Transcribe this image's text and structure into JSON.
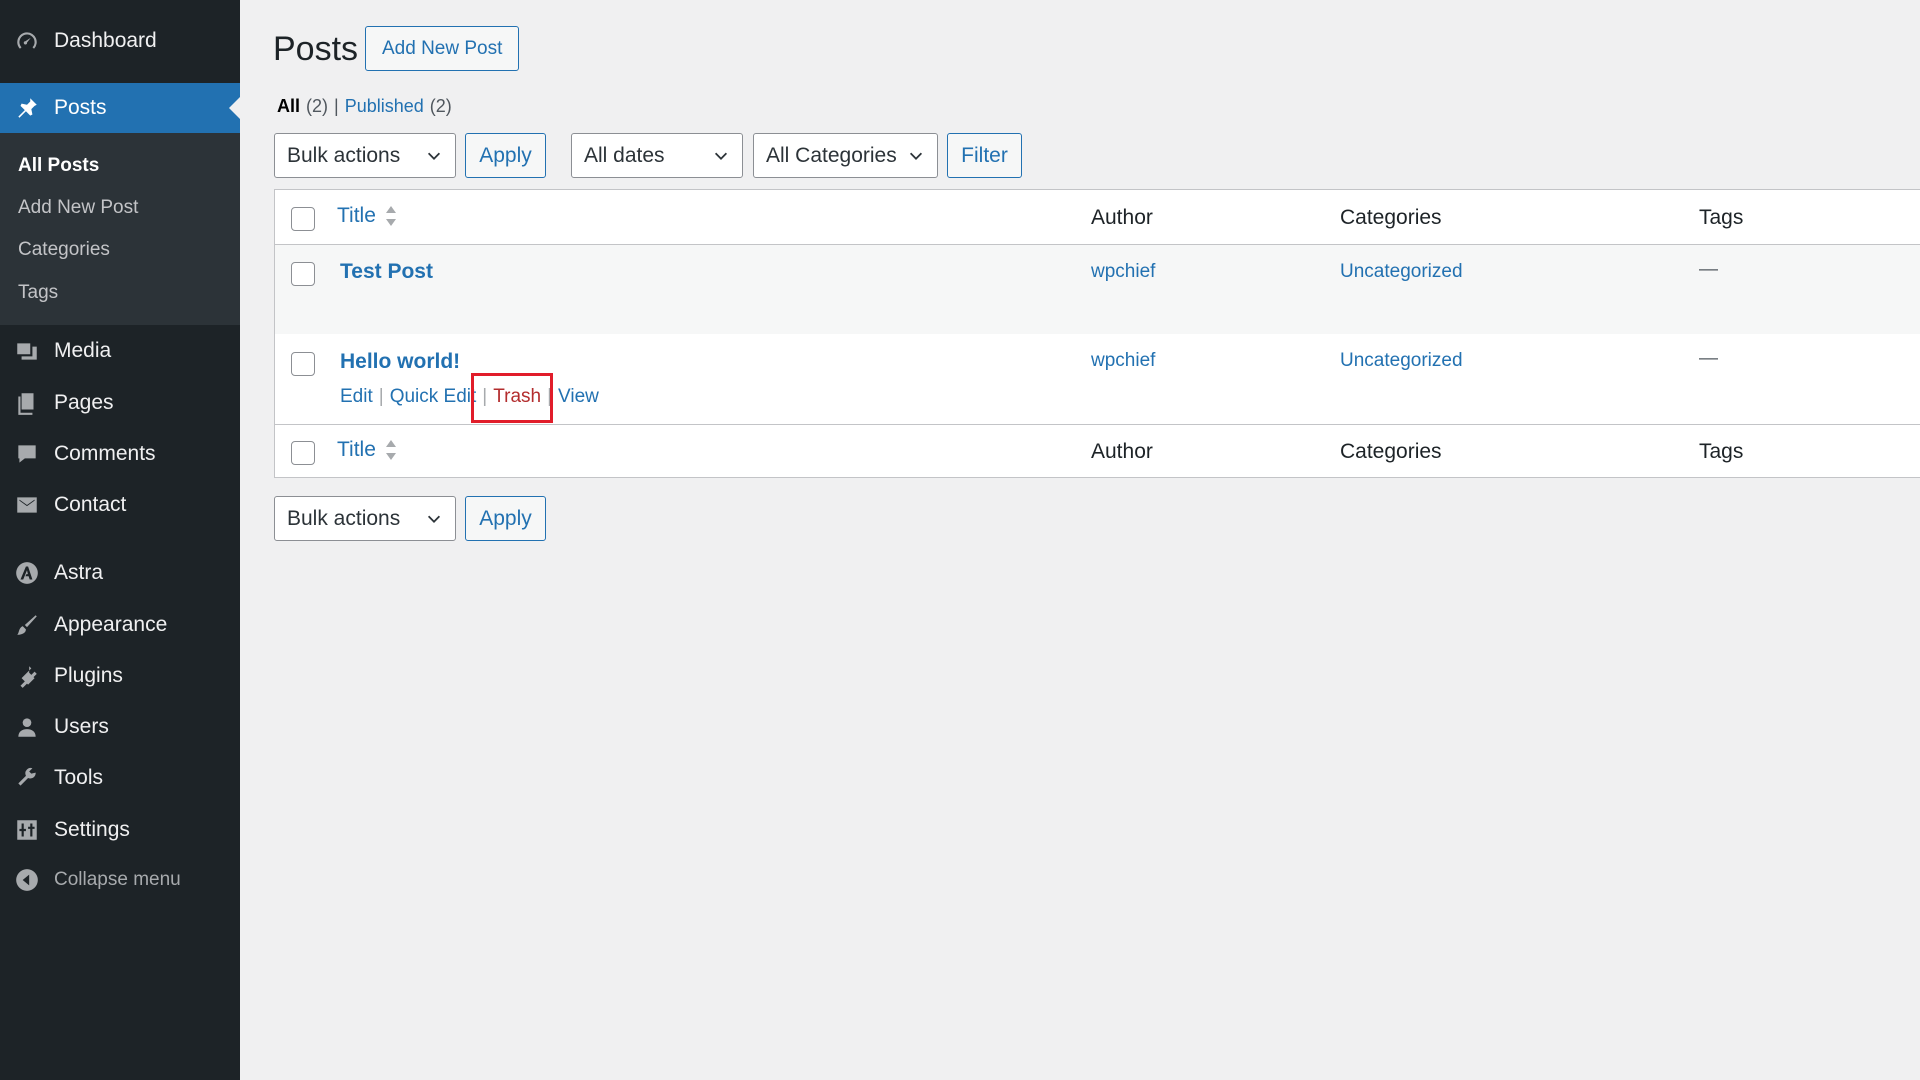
{
  "sidebar": {
    "items": [
      {
        "label": "Dashboard",
        "icon": "dashboard-icon"
      },
      {
        "label": "Posts",
        "icon": "pin-icon",
        "current": true
      },
      {
        "label": "Media",
        "icon": "media-icon"
      },
      {
        "label": "Pages",
        "icon": "pages-icon"
      },
      {
        "label": "Comments",
        "icon": "comments-icon"
      },
      {
        "label": "Contact",
        "icon": "mail-icon"
      },
      {
        "label": "Astra",
        "icon": "astra-icon"
      },
      {
        "label": "Appearance",
        "icon": "brush-icon"
      },
      {
        "label": "Plugins",
        "icon": "plugin-icon"
      },
      {
        "label": "Users",
        "icon": "users-icon"
      },
      {
        "label": "Tools",
        "icon": "wrench-icon"
      },
      {
        "label": "Settings",
        "icon": "settings-icon"
      },
      {
        "label": "Collapse menu",
        "icon": "collapse-icon"
      }
    ],
    "submenu": [
      {
        "label": "All Posts",
        "current": true
      },
      {
        "label": "Add New Post"
      },
      {
        "label": "Categories"
      },
      {
        "label": "Tags"
      }
    ]
  },
  "header": {
    "title": "Posts",
    "add_new_label": "Add New Post"
  },
  "filters": {
    "all_label": "All",
    "all_count": "(2)",
    "separator": "|",
    "published_label": "Published",
    "published_count": "(2)"
  },
  "toolbar": {
    "bulk_actions": "Bulk actions",
    "apply_label": "Apply",
    "dates": "All dates",
    "categories": "All Categories",
    "filter_label": "Filter"
  },
  "table": {
    "columns": {
      "title": "Title",
      "author": "Author",
      "categories": "Categories",
      "tags": "Tags"
    },
    "rows": [
      {
        "title": "Test Post",
        "author": "wpchief",
        "category": "Uncategorized",
        "tags": "—"
      },
      {
        "title": "Hello world!",
        "author": "wpchief",
        "category": "Uncategorized",
        "tags": "—"
      }
    ],
    "row_actions": {
      "edit": "Edit",
      "quick_edit": "Quick Edit",
      "trash": "Trash",
      "view": "View",
      "separator": "|"
    }
  },
  "colors": {
    "sidebar_bg": "#1d2327",
    "accent": "#2271b1",
    "trash": "#b32d2e",
    "highlight": "#e11d2a"
  }
}
